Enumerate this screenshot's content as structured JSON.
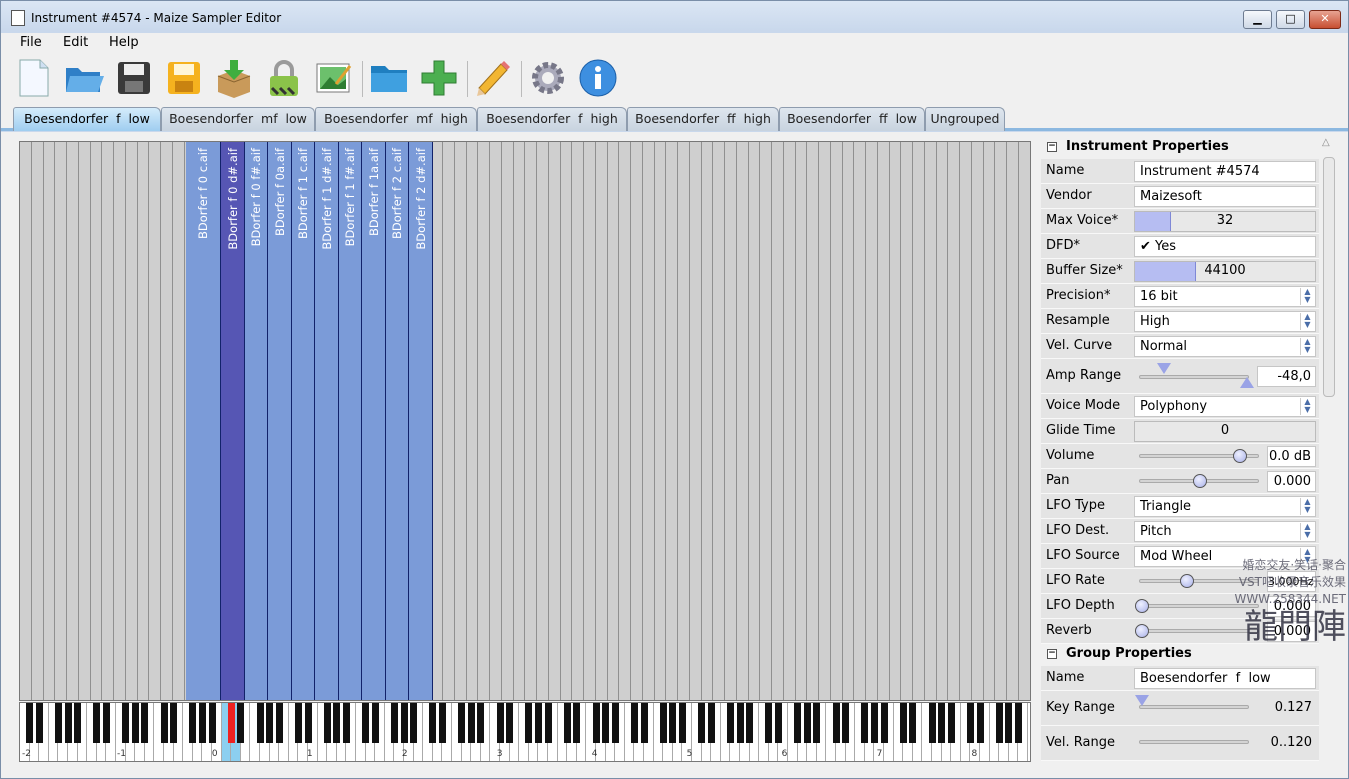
{
  "window": {
    "title": "Instrument #4574 - Maize Sampler Editor",
    "minimize": "▁",
    "maximize": "□",
    "close": "✕"
  },
  "menu": [
    "File",
    "Edit",
    "Help"
  ],
  "toolbar": {
    "icons": [
      "new-file-icon",
      "open-folder-icon",
      "save-disk-icon",
      "save-as-disk-icon",
      "import-box-icon",
      "lock-icon",
      "image-edit-icon",
      "folder-icon",
      "add-plus-icon",
      "pencil-icon",
      "gear-icon",
      "info-icon"
    ]
  },
  "tabs": [
    "Boesendorfer  f  low",
    "Boesendorfer  mf  low",
    "Boesendorfer  mf  high",
    "Boesendorfer  f  high",
    "Boesendorfer  ff  high",
    "Boesendorfer  ff  low",
    "Ungrouped"
  ],
  "samples": [
    "BDorfer f 0 c.aif",
    "BDorfer f 0 d#.aif",
    "BDorfer f 0 f#.aif",
    "BDorfer f 0a.aif",
    "BDorfer f 1 c.aif",
    "BDorfer f 1 d#.aif",
    "BDorfer f 1 f#.aif",
    "BDorfer f 1a.aif",
    "BDorfer f 2 c.aif",
    "BDorfer f 2 d#.aif"
  ],
  "octave_labels": [
    "-2",
    "-1",
    "0",
    "1",
    "2",
    "3",
    "4",
    "5",
    "6",
    "7",
    "8"
  ],
  "instrument_properties": {
    "header": "Instrument Properties",
    "collapse": "−",
    "name_label": "Name",
    "name": "Instrument #4574",
    "vendor_label": "Vendor",
    "vendor": "Maizesoft",
    "max_voice_label": "Max Voice*",
    "max_voice": "32",
    "max_voice_level": 0.2,
    "dfd_label": "DFD*",
    "dfd_check": "✔",
    "dfd": "Yes",
    "buffer_label": "Buffer Size*",
    "buffer": "44100",
    "buffer_level": 0.34,
    "precision_label": "Precision*",
    "precision": "16 bit",
    "resample_label": "Resample",
    "resample": "High",
    "vel_curve_label": "Vel. Curve",
    "vel_curve": "Normal",
    "amp_range_label": "Amp Range",
    "amp_range": "-48,0",
    "voice_mode_label": "Voice Mode",
    "voice_mode": "Polyphony",
    "glide_label": "Glide Time",
    "glide": "0",
    "volume_label": "Volume",
    "volume": "0.0 dB",
    "pan_label": "Pan",
    "pan": "0.000",
    "lfo_type_label": "LFO Type",
    "lfo_type": "Triangle",
    "lfo_dest_label": "LFO Dest.",
    "lfo_dest": "Pitch",
    "lfo_source_label": "LFO Source",
    "lfo_source": "Mod Wheel",
    "lfo_rate_label": "LFO Rate",
    "lfo_rate": "3.000Hz",
    "lfo_depth_label": "LFO Depth",
    "lfo_depth": "0.000",
    "reverb_label": "Reverb",
    "reverb": "0.000"
  },
  "group_properties": {
    "header": "Group Properties",
    "collapse": "−",
    "name_label": "Name",
    "name": "Boesendorfer  f  low",
    "key_range_label": "Key Range",
    "key_range": "0.127",
    "vel_range_label": "Vel. Range",
    "vel_range": "0..120"
  },
  "watermark": {
    "line1": "婚恋交友·笑话·聚合",
    "line2": "VST吧收录音乐效果",
    "line3": "WWW.258344.NET",
    "line4": "龍門陣"
  },
  "colors": {
    "sample_fill": "#7b9bd8",
    "sample_selected": "#5656b4",
    "highlight_key": "#e22222",
    "tab_active": "#9fcdf0"
  }
}
